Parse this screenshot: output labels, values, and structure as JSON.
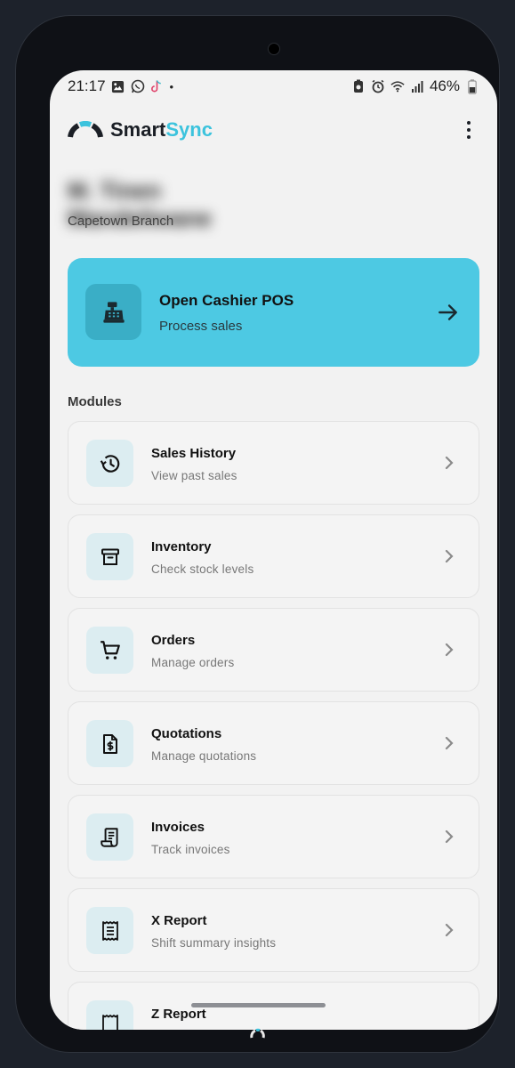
{
  "status_bar": {
    "time": "21:17",
    "dot": "•",
    "battery": "46%"
  },
  "header": {
    "brand_part1": "Smart",
    "brand_part2": "Sync",
    "menu_icon": "more-vertical-icon"
  },
  "user": {
    "name": "M. Tinen Mandeliwane",
    "branch": "Capetown Branch"
  },
  "pos_card": {
    "title": "Open Cashier POS",
    "subtitle": "Process sales",
    "icon": "cash-register-icon",
    "color": "#4dc9e3"
  },
  "modules_label": "Modules",
  "modules": [
    {
      "title": "Sales History",
      "subtitle": "View past sales",
      "icon": "history-icon"
    },
    {
      "title": "Inventory",
      "subtitle": "Check stock levels",
      "icon": "archive-box-icon"
    },
    {
      "title": "Orders",
      "subtitle": "Manage orders",
      "icon": "cart-icon"
    },
    {
      "title": "Quotations",
      "subtitle": "Manage quotations",
      "icon": "dollar-document-icon"
    },
    {
      "title": "Invoices",
      "subtitle": "Track invoices",
      "icon": "receipt-icon"
    },
    {
      "title": "X Report",
      "subtitle": "Shift summary insights",
      "icon": "report-icon"
    },
    {
      "title": "Z Report",
      "subtitle": "",
      "icon": "report-icon"
    }
  ],
  "colors": {
    "accent": "#4dc9e3",
    "background": "#f2f2f2",
    "icon_bg": "#dcedf1"
  }
}
